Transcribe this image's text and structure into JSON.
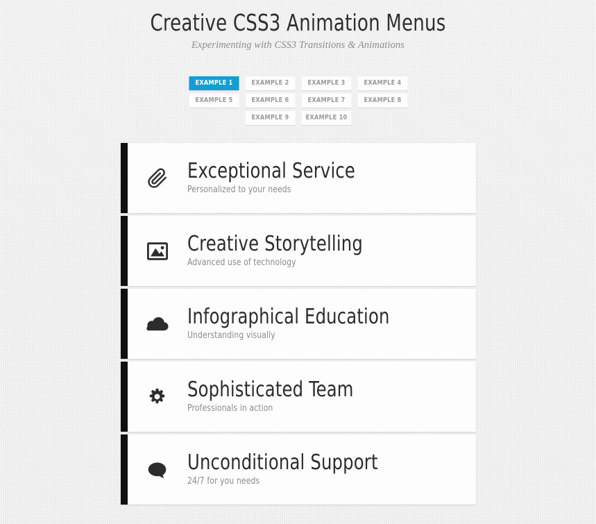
{
  "header": {
    "title": "Creative CSS3 Animation Menus",
    "subtitle": "Experimenting with CSS3 Transitions & Animations"
  },
  "colors": {
    "active_button_bg": "#109fd2",
    "active_button_text": "#ffffff",
    "button_bg": "#fdfdfd",
    "button_text": "#9a9a9a",
    "card_bg": "#fdfdfd",
    "card_accent_bar": "#101010",
    "heading_text": "#2c2c2c",
    "subtitle_text": "#8b8b8b",
    "page_background": "#eaeaea"
  },
  "example_nav": {
    "active_index": 0,
    "buttons": [
      {
        "label": "Example 1",
        "active": true
      },
      {
        "label": "Example 2",
        "active": false
      },
      {
        "label": "Example 3",
        "active": false
      },
      {
        "label": "Example 4",
        "active": false
      },
      {
        "label": "Example 5",
        "active": false
      },
      {
        "label": "Example 6",
        "active": false
      },
      {
        "label": "Example 7",
        "active": false
      },
      {
        "label": "Example 8",
        "active": false
      },
      {
        "label": "Example 9",
        "active": false
      },
      {
        "label": "Example 10",
        "active": false
      }
    ]
  },
  "menu": {
    "items": [
      {
        "icon": "paperclip-icon",
        "heading": "Exceptional Service",
        "subtitle": "Personalized to your needs"
      },
      {
        "icon": "picture-icon",
        "heading": "Creative Storytelling",
        "subtitle": "Advanced use of technology"
      },
      {
        "icon": "cloud-icon",
        "heading": "Infographical Education",
        "subtitle": "Understanding visually"
      },
      {
        "icon": "gear-icon",
        "heading": "Sophisticated Team",
        "subtitle": "Professionals in action"
      },
      {
        "icon": "speech-bubble-icon",
        "heading": "Unconditional Support",
        "subtitle": "24/7 for you needs"
      }
    ]
  }
}
